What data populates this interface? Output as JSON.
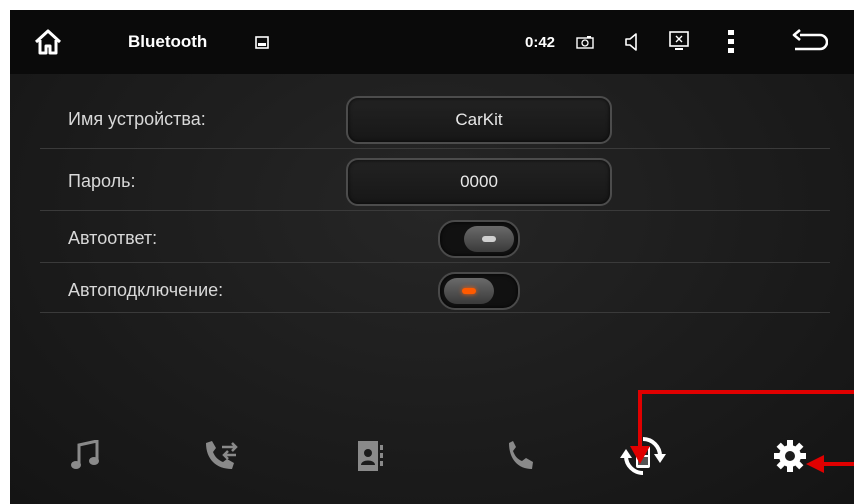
{
  "status_bar": {
    "title": "Bluetooth",
    "time": "0:42",
    "icons": [
      "home-icon",
      "gallery-icon",
      "camera-icon",
      "volume-icon",
      "screen-close-icon",
      "more-menu-icon",
      "back-icon"
    ]
  },
  "settings": {
    "device_name": {
      "label": "Имя устройства:",
      "value": "CarKit"
    },
    "password": {
      "label": "Пароль:",
      "value": "0000"
    },
    "auto_answer": {
      "label": "Автоответ:",
      "enabled": false
    },
    "auto_connect": {
      "label": "Автоподключение:",
      "enabled": true
    }
  },
  "bottom_nav": {
    "items": [
      "music-icon",
      "call-log-icon",
      "contacts-icon",
      "phone-icon",
      "devices-icon",
      "settings-icon"
    ],
    "active": "settings-icon"
  },
  "colors": {
    "statusbar_bg": "#0a0a0a",
    "icon": "#8a8a8a",
    "toggle_on_indicator": "#ff5a00",
    "toggle_off_indicator": "#d0d0d0",
    "annotation": "#e00000"
  }
}
